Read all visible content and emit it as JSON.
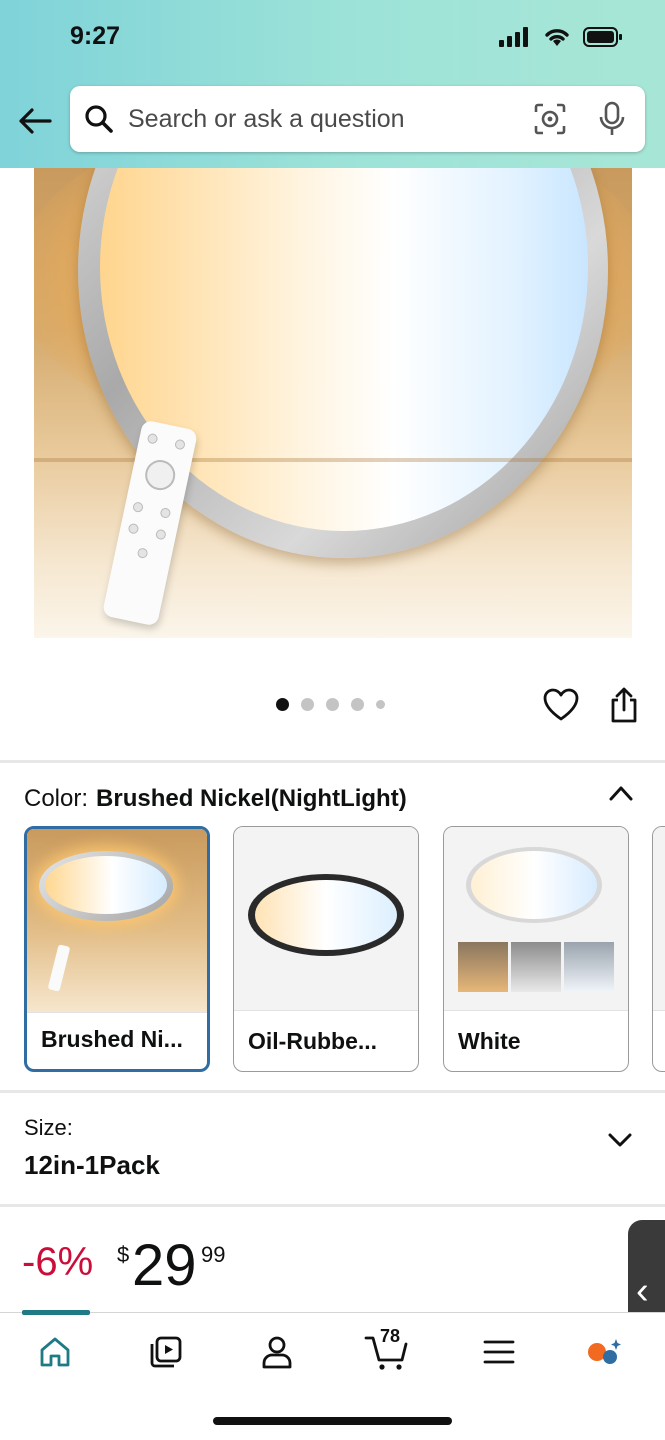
{
  "status_bar": {
    "time": "9:27"
  },
  "search": {
    "placeholder": "Search or ask a question"
  },
  "carousel": {
    "total": 5,
    "active": 1
  },
  "color": {
    "label": "Color:",
    "selected_value": "Brushed Nickel(NightLight)",
    "options": [
      {
        "label": "Brushed Ni..."
      },
      {
        "label": "Oil-Rubbe..."
      },
      {
        "label": "White"
      }
    ]
  },
  "size": {
    "label": "Size:",
    "value": "12in-1Pack"
  },
  "price": {
    "discount": "-6%",
    "currency": "$",
    "whole": "29",
    "fraction": "99"
  },
  "cart": {
    "count": "78"
  },
  "colors": {
    "accent_selected": "#2f6da3",
    "discount": "#cc0c39",
    "nav_indicator": "#1e7b86"
  }
}
